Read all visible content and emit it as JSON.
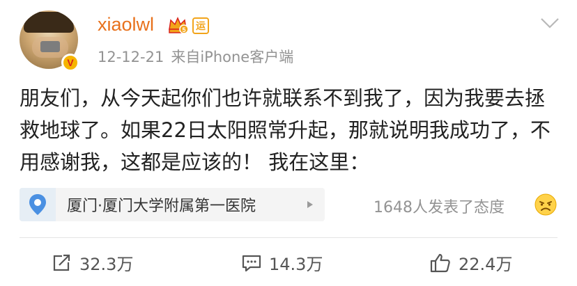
{
  "post": {
    "username": "xiaolwl",
    "date": "12-12-21",
    "source": "来自iPhone客户端",
    "content": "朋友们，从今天起你们也许就联系不到我了，因为我要去拯救地球了。如果22日太阳照常升起，那就说明我成功了，不用感谢我，这都是应该的！ 我在这里：",
    "location": "厦门·厦门大学附属第一医院",
    "attitude_text": "1648人发表了态度",
    "badges": {
      "verified": "V",
      "yun": "运"
    }
  },
  "actions": {
    "repost_count": "32.3万",
    "comment_count": "14.3万",
    "like_count": "22.4万"
  },
  "icons": {
    "verified": "verified-v-icon",
    "crown": "crown-level-icon",
    "yun": "yun-badge-icon",
    "more": "chevron-down-icon",
    "pin": "location-pin-icon",
    "arrow": "play-arrow-icon",
    "emoji": "emoji-icon",
    "repost": "repost-icon",
    "comment": "comment-icon",
    "like": "thumbs-up-icon"
  },
  "colors": {
    "username": "#e8711c",
    "meta": "#939393",
    "accent_gold": "#f6b400",
    "verified_red": "#d9231c"
  }
}
